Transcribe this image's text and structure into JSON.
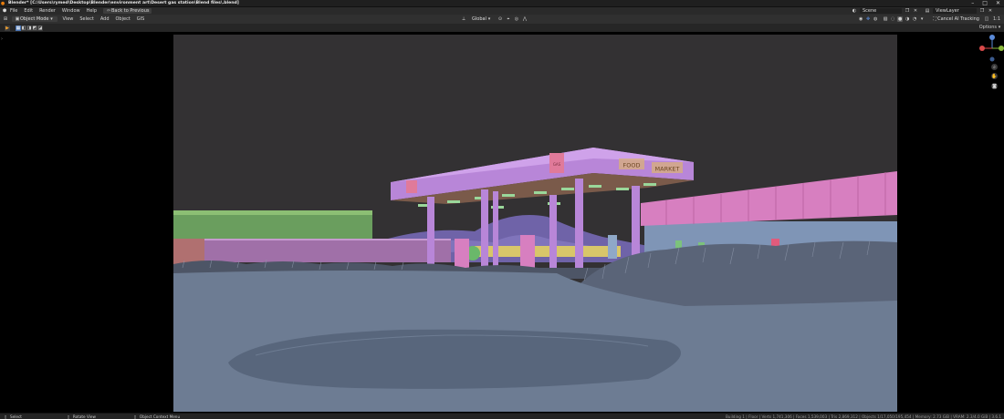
{
  "window": {
    "title": "Blender* [C:\\Users\\rymed\\Desktop\\Blender\\environment art\\Desert gas station\\Blend files\\.blend]"
  },
  "menu": {
    "file": "File",
    "edit": "Edit",
    "render": "Render",
    "window": "Window",
    "help": "Help",
    "back_to_previous": "Back to Previous"
  },
  "workspace": {
    "scene_name": "Scene",
    "view_layer": "ViewLayer"
  },
  "header3d": {
    "mode": "Object Mode",
    "view": "View",
    "select": "Select",
    "add": "Add",
    "object": "Object",
    "gis": "GIS",
    "orientation": "Global",
    "tracking": "Cancel AI Tracking",
    "zoom": "1:1",
    "options": "Options"
  },
  "statusbar": {
    "left1": "Select",
    "left2": "Rotate View",
    "left3": "Object Context Menu",
    "stats": "Building 1 | Floor | Verts 1,741,306 | Faces 1,539,003 | Tris 2,869,312 | Objects 1/17,050/195,454 | Memory: 2.73 GiB | VRAM: 2.3/4.0 GiB | 3.6.1"
  },
  "scene": {
    "sign_left": "FOOD",
    "sign_right": "MARKET",
    "canopy_badge": "GAS"
  },
  "colors": {
    "canopy": "#b886d8",
    "ground": "#6d7c93",
    "sky": "#323032",
    "wall_pink": "#d77fc0",
    "wall_green": "#6a9e5e",
    "building_blue": "#7f95b6"
  }
}
